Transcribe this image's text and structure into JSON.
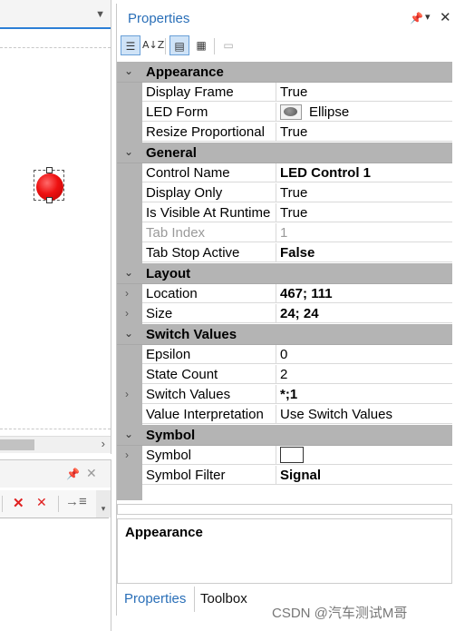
{
  "left_pane": {
    "designer_collapse_glyph": "▼",
    "hscroll_arrow": "›"
  },
  "output_pane": {
    "pin_glyph": "📌",
    "close_glyph": "✕"
  },
  "properties": {
    "title": "Properties",
    "pin_glyph": "📌",
    "dropdown_glyph": "▾",
    "close_glyph": "✕",
    "toolbar": {
      "az_label": "A↓Z"
    },
    "categories": [
      {
        "label": "Appearance",
        "rows": [
          {
            "name": "Display Frame",
            "value": "True"
          },
          {
            "name": "LED Form",
            "value": "Ellipse"
          },
          {
            "name": "Resize Proportional",
            "value": "True"
          }
        ]
      },
      {
        "label": "General",
        "rows": [
          {
            "name": "Control Name",
            "value": "LED Control 1"
          },
          {
            "name": "Display Only",
            "value": "True"
          },
          {
            "name": "Is Visible At Runtime",
            "value": "True"
          },
          {
            "name": "Tab Index",
            "value": "1"
          },
          {
            "name": "Tab Stop Active",
            "value": "False"
          }
        ]
      },
      {
        "label": "Layout",
        "rows": [
          {
            "name": "Location",
            "value": "467; 111"
          },
          {
            "name": "Size",
            "value": "24; 24"
          }
        ]
      },
      {
        "label": "Switch Values",
        "rows": [
          {
            "name": "Epsilon",
            "value": "0"
          },
          {
            "name": "State Count",
            "value": "2"
          },
          {
            "name": "Switch Values",
            "value": "*;1"
          },
          {
            "name": "Value Interpretation",
            "value": "Use Switch Values"
          }
        ]
      },
      {
        "label": "Symbol",
        "rows": [
          {
            "name": "Symbol",
            "value": ""
          },
          {
            "name": "Symbol Filter",
            "value": "Signal"
          }
        ]
      }
    ],
    "description_title": "Appearance",
    "bottom_tabs": [
      "Properties",
      "Toolbox"
    ]
  },
  "watermark": "CSDN @汽车测试M哥",
  "colors": {
    "accent": "#2a6fb8",
    "category_bg": "#b4b4b4",
    "led_red": "#ee1111"
  }
}
